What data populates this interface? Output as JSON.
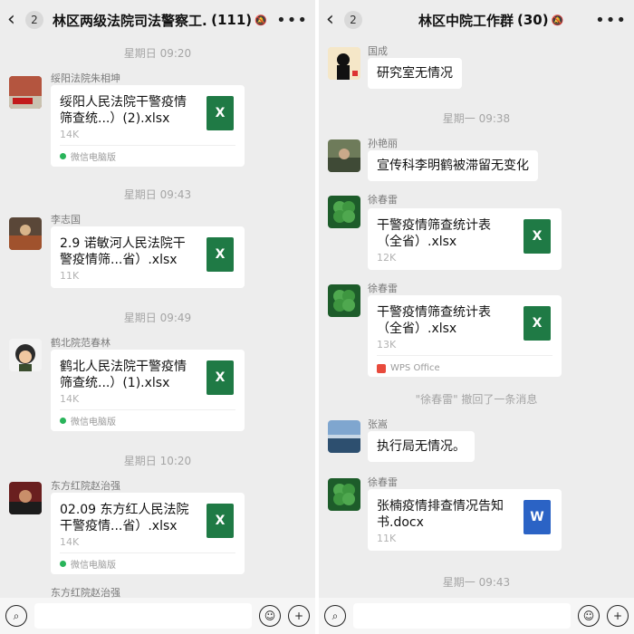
{
  "left": {
    "back_badge": "2",
    "title": "林区两级法院司法警察工...",
    "count": "(111)",
    "times": [
      "星期日 09:20",
      "星期日 09:43",
      "星期日 09:49",
      "星期日 10:20"
    ],
    "messages": [
      {
        "sender": "绥阳法院朱相坤",
        "file_name": "绥阳人民法院干警疫情筛查统...）(2).xlsx",
        "size": "14K",
        "source": "微信电脑版",
        "file_type": "X"
      },
      {
        "sender": "李志国",
        "file_name": "2.9 诺敏河人民法院干警疫情筛...省）.xlsx",
        "size": "11K",
        "source": "",
        "file_type": "X"
      },
      {
        "sender": "鹤北院范春林",
        "file_name": "鹤北人民法院干警疫情筛查统...）(1).xlsx",
        "size": "14K",
        "source": "微信电脑版",
        "file_type": "X"
      },
      {
        "sender": "东方红院赵治强",
        "file_name": "02.09 东方红人民法院干警疫情...省）.xlsx",
        "size": "14K",
        "source": "微信电脑版",
        "file_type": "X"
      }
    ],
    "partial_sender": "东方红院赵治强"
  },
  "right": {
    "back_badge": "2",
    "title": "林区中院工作群",
    "count": "(30)",
    "times": [
      "星期一 09:38",
      "星期一 09:43"
    ],
    "messages": [
      {
        "sender": "国成",
        "text": "研究室无情况"
      },
      {
        "sender": "孙艳丽",
        "text": "宣传科李明鹤被滞留无变化"
      },
      {
        "sender": "徐春雷",
        "file_name": "干警疫情筛查统计表（全省）.xlsx",
        "size": "12K",
        "file_type": "X"
      },
      {
        "sender": "徐春雷",
        "file_name": "干警疫情筛查统计表（全省）.xlsx",
        "size": "13K",
        "source": "WPS Office",
        "file_type": "X"
      },
      {
        "sender": "张嵩",
        "text": "执行局无情况。"
      },
      {
        "sender": "徐春雷",
        "file_name": "张楠疫情排查情况告知书.docx",
        "size": "11K",
        "file_type": "W"
      }
    ],
    "recall_notice": "\"徐春雷\" 撤回了一条消息"
  },
  "colors": {
    "excel": "#1f7a45",
    "word": "#2b63c5",
    "background": "#ededed",
    "bubble": "#ffffff"
  },
  "icons": {
    "back": "chevron-left-icon",
    "mute": "bell-off-icon",
    "more": "more-dots-icon",
    "voice": "voice-icon",
    "emoji": "emoji-icon",
    "plus": "plus-icon"
  }
}
